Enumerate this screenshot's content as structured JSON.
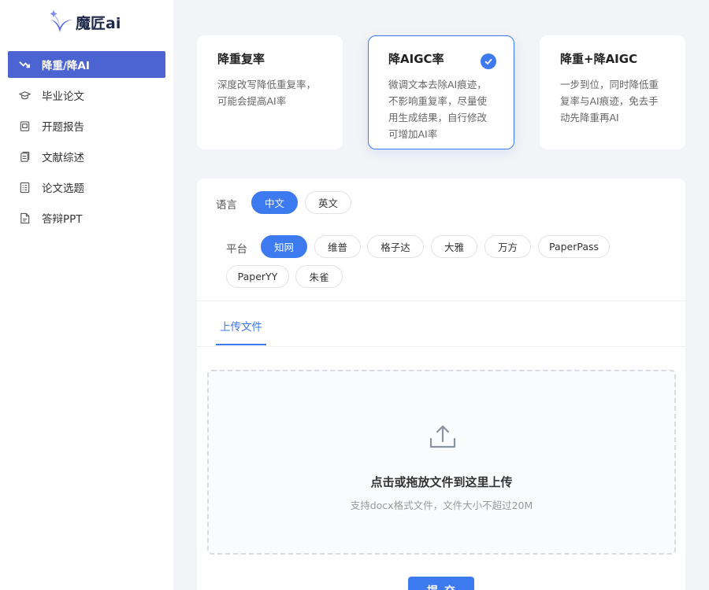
{
  "app": {
    "logo_text": "魔匠ai"
  },
  "sidebar": {
    "items": [
      {
        "label": "降重/降AI",
        "icon": "trend-down-icon",
        "active": true
      },
      {
        "label": "毕业论文",
        "icon": "graduation-cap-icon"
      },
      {
        "label": "开题报告",
        "icon": "report-icon"
      },
      {
        "label": "文献综述",
        "icon": "documents-icon"
      },
      {
        "label": "论文选题",
        "icon": "list-doc-icon"
      },
      {
        "label": "答辩PPT",
        "icon": "file-icon"
      }
    ]
  },
  "modes": [
    {
      "title": "降重复率",
      "desc": "深度改写降低重复率，可能会提高AI率"
    },
    {
      "title": "降AIGC率",
      "desc": "微调文本去除AI痕迹，不影响重复率，尽量使用生成结果，自行修改可增加AI率",
      "selected": true
    },
    {
      "title": "降重+降AIGC",
      "desc": "一步到位，同时降低重复率与AI痕迹，免去手动先降重再AI"
    }
  ],
  "language": {
    "label": "语言",
    "options": [
      "中文",
      "英文"
    ],
    "selected": "中文"
  },
  "platform": {
    "label": "平台",
    "options": [
      "知网",
      "维普",
      "格子达",
      "大雅",
      "万方",
      "PaperPass",
      "PaperYY",
      "朱雀"
    ],
    "selected": "知网"
  },
  "upload": {
    "tab_label": "上传文件",
    "title": "点击或拖放文件到这里上传",
    "subtitle": "支持docx格式文件，文件大小不超过20M"
  },
  "submit_label": "提交",
  "colors": {
    "accent": "#3d7af0",
    "sidebar_active": "#4c63d2"
  }
}
